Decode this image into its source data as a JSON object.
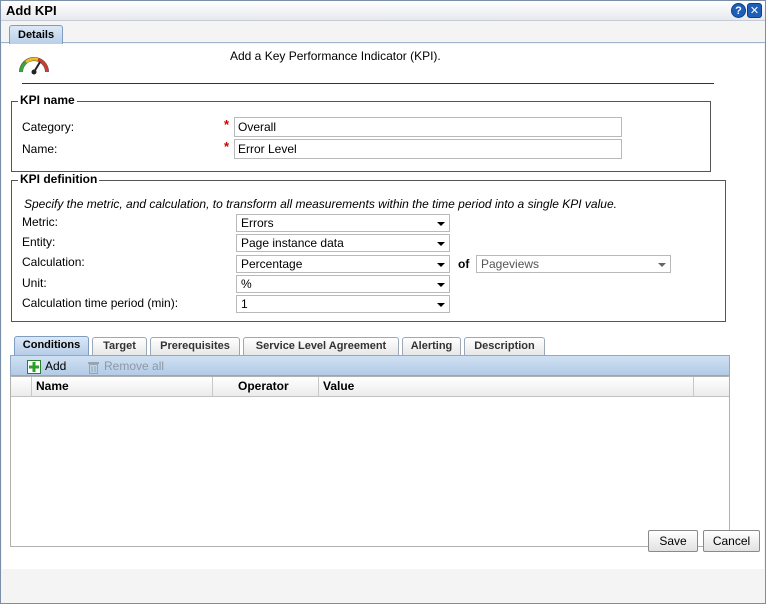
{
  "window": {
    "title": "Add KPI",
    "help_label": "?",
    "close_label": "✕"
  },
  "tabs": {
    "details": "Details"
  },
  "intro": "Add a Key Performance Indicator (KPI).",
  "kpi_name": {
    "legend": "KPI name",
    "category_label": "Category:",
    "category_value": "Overall",
    "name_label": "Name:",
    "name_value": "Error Level",
    "required_mark": "*"
  },
  "kpi_definition": {
    "legend": "KPI definition",
    "hint": "Specify the metric, and calculation, to transform all measurements within the time period into a single KPI value.",
    "metric_label": "Metric:",
    "metric_value": "Errors",
    "entity_label": "Entity:",
    "entity_value": "Page instance data",
    "calculation_label": "Calculation:",
    "calculation_value": "Percentage",
    "of_label": "of",
    "of_value": "Pageviews",
    "unit_label": "Unit:",
    "unit_value": "%",
    "period_label": "Calculation time period (min):",
    "period_value": "1"
  },
  "subtabs": [
    "Conditions",
    "Target",
    "Prerequisites",
    "Service Level Agreement",
    "Alerting",
    "Description"
  ],
  "toolbar": {
    "add_label": "Add",
    "remove_all_label": "Remove all"
  },
  "grid": {
    "columns": [
      "Name",
      "Operator",
      "Value"
    ],
    "rows": []
  },
  "footer": {
    "save_label": "Save",
    "cancel_label": "Cancel"
  }
}
